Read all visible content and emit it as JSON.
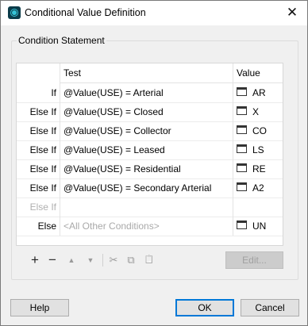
{
  "window": {
    "title": "Conditional Value Definition",
    "close_glyph": "✕",
    "app_icon": "app-logo-icon"
  },
  "group": {
    "label": "Condition Statement"
  },
  "grid": {
    "columns": {
      "test": "Test",
      "value": "Value"
    },
    "rows": [
      {
        "label": "If",
        "condition": "@Value(USE) = Arterial",
        "value": "AR",
        "has_value": true,
        "disabled": false,
        "placeholder": false
      },
      {
        "label": "Else If",
        "condition": "@Value(USE) = Closed",
        "value": "X",
        "has_value": true,
        "disabled": false,
        "placeholder": false
      },
      {
        "label": "Else If",
        "condition": "@Value(USE) = Collector",
        "value": "CO",
        "has_value": true,
        "disabled": false,
        "placeholder": false
      },
      {
        "label": "Else If",
        "condition": "@Value(USE) = Leased",
        "value": "LS",
        "has_value": true,
        "disabled": false,
        "placeholder": false
      },
      {
        "label": "Else If",
        "condition": "@Value(USE) = Residential",
        "value": "RE",
        "has_value": true,
        "disabled": false,
        "placeholder": false
      },
      {
        "label": "Else If",
        "condition": "@Value(USE) = Secondary Arterial",
        "value": "A2",
        "has_value": true,
        "disabled": false,
        "placeholder": false
      },
      {
        "label": "Else If",
        "condition": "",
        "value": "",
        "has_value": false,
        "disabled": true,
        "placeholder": false
      },
      {
        "label": "Else",
        "condition": "<All Other Conditions>",
        "value": "UN",
        "has_value": true,
        "disabled": false,
        "placeholder": true
      }
    ]
  },
  "toolbar": {
    "add": "+",
    "remove": "−",
    "move_up": "▲",
    "move_down": "▼",
    "cut": "✂",
    "copy": "⧉",
    "paste": "📋",
    "edit_label": "Edit..."
  },
  "footer": {
    "help_label": "Help",
    "ok_label": "OK",
    "cancel_label": "Cancel"
  }
}
